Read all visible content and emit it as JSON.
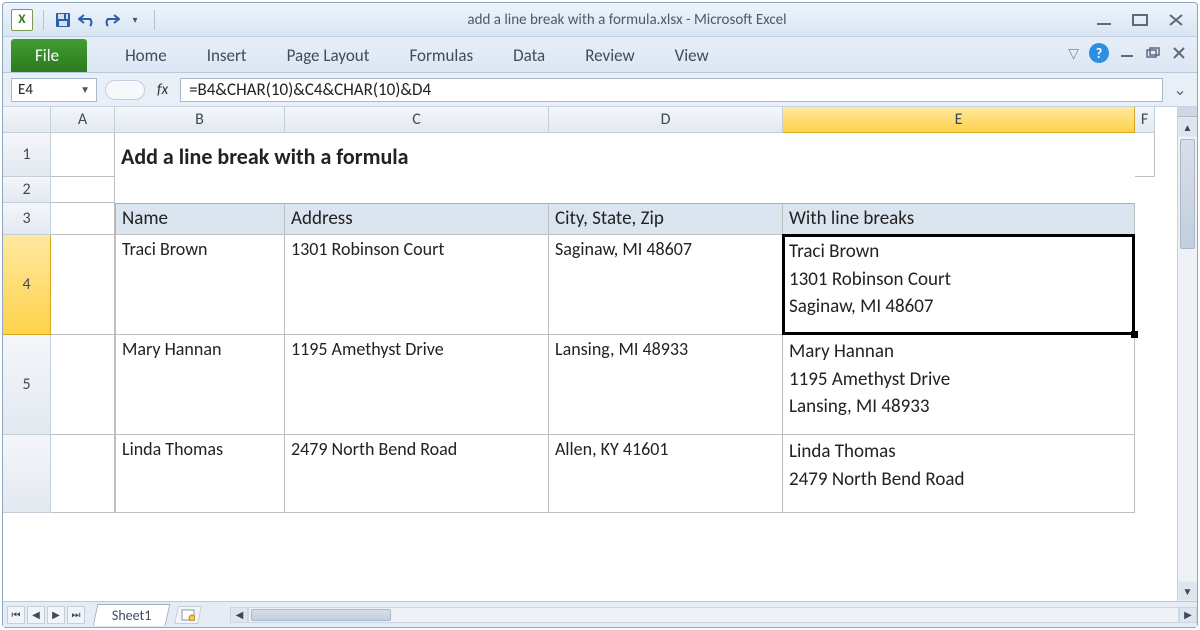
{
  "window": {
    "title": "add a line break with a formula.xlsx  -  Microsoft Excel"
  },
  "ribbon": {
    "file": "File",
    "tabs": [
      "Home",
      "Insert",
      "Page Layout",
      "Formulas",
      "Data",
      "Review",
      "View"
    ]
  },
  "namebox": {
    "value": "E4"
  },
  "formula": {
    "value": "=B4&CHAR(10)&C4&CHAR(10)&D4",
    "label": "fx"
  },
  "columns": [
    "A",
    "B",
    "C",
    "D",
    "E",
    "F"
  ],
  "rows": [
    "1",
    "2",
    "3",
    "4",
    "5"
  ],
  "selected": {
    "col": "E",
    "row": "4"
  },
  "content": {
    "title": "Add a line break with a formula",
    "headers": [
      "Name",
      "Address",
      "City, State, Zip",
      "With line breaks"
    ],
    "data": [
      {
        "name": "Traci Brown",
        "address": "1301 Robinson Court",
        "csz": "Saginaw, MI 48607",
        "combined": "Traci Brown\n1301 Robinson Court\nSaginaw, MI 48607"
      },
      {
        "name": "Mary Hannan",
        "address": "1195 Amethyst Drive",
        "csz": "Lansing, MI 48933",
        "combined": "Mary Hannan\n1195 Amethyst Drive\nLansing, MI 48933"
      },
      {
        "name": "Linda Thomas",
        "address": "2479 North Bend Road",
        "csz": "Allen, KY 41601",
        "combined": "Linda Thomas\n2479 North Bend Road"
      }
    ]
  },
  "sheets": {
    "active": "Sheet1"
  }
}
